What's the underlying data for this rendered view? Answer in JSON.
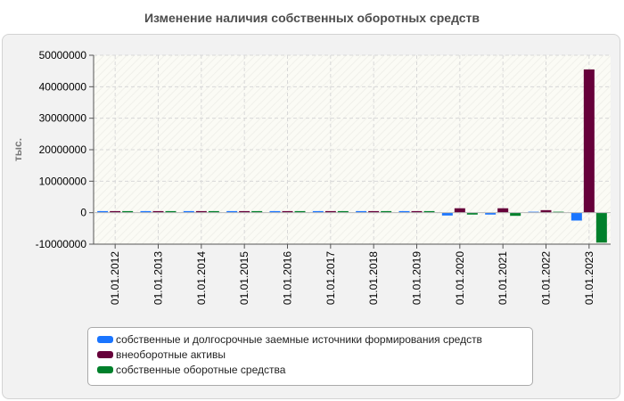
{
  "title": "Изменение наличия собственных оборотных средств",
  "colors": {
    "series_0": "#1a75ff",
    "series_1": "#66003a",
    "series_2": "#00802b",
    "grid": "#d8d8d8",
    "axis": "#555555"
  },
  "chart_data": {
    "type": "bar",
    "title": "Изменение наличия собственных оборотных средств",
    "ylabel": "тыс.",
    "xlabel": "",
    "ylim": [
      -10000000,
      50000000
    ],
    "yticks": [
      -10000000,
      0,
      10000000,
      20000000,
      30000000,
      40000000,
      50000000
    ],
    "ytick_labels": [
      "-10000000",
      "0",
      "10000000",
      "20000000",
      "30000000",
      "40000000",
      "50000000"
    ],
    "grid": true,
    "legend_position": "bottom",
    "categories": [
      "01.01.2012",
      "01.01.2013",
      "01.01.2014",
      "01.01.2015",
      "01.01.2016",
      "01.01.2017",
      "01.01.2018",
      "01.01.2019",
      "01.01.2020",
      "01.01.2021",
      "01.01.2022",
      "01.01.2023"
    ],
    "series": [
      {
        "name": "собственные и долгосрочные заемные источники формирования средств",
        "color": "#1a75ff",
        "values": [
          500000,
          500000,
          500000,
          500000,
          500000,
          500000,
          500000,
          500000,
          -900000,
          -600000,
          300000,
          -2500000
        ]
      },
      {
        "name": "внеоборотные активы",
        "color": "#66003a",
        "values": [
          500000,
          500000,
          500000,
          500000,
          500000,
          500000,
          500000,
          500000,
          1400000,
          1400000,
          800000,
          45500000
        ]
      },
      {
        "name": "собственные оборотные средства",
        "color": "#00802b",
        "values": [
          500000,
          500000,
          500000,
          500000,
          500000,
          500000,
          500000,
          500000,
          -600000,
          -1000000,
          300000,
          -9500000
        ]
      }
    ]
  }
}
